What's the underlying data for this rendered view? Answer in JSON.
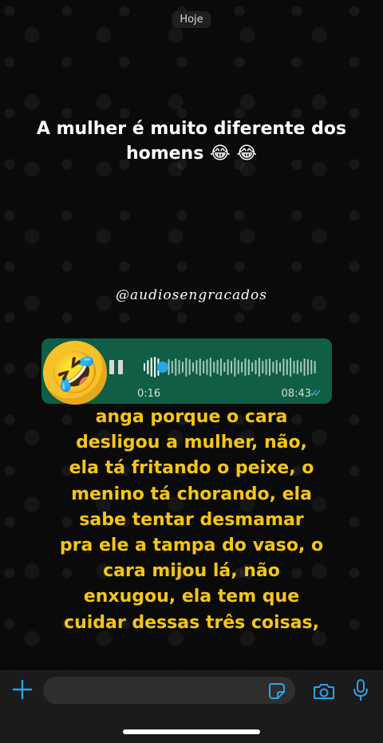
{
  "chat": {
    "date_chip": "Hoje",
    "overlay_title": "A mulher é muito diferente dos homens 😂 😂",
    "watermark": "@audiosengracados",
    "voice_message": {
      "avatar_emoji": "🤣",
      "duration": "0:16",
      "time": "08:43",
      "status": "read",
      "progress": 0.1
    },
    "caption": "anga porque o cara\ndesligou a mulher, não,\nela tá fritando o peixe, o\nmenino tá chorando, ela\nsabe tentar desmamar\npra ele a tampa do vaso, o\ncara mijou lá, não\nenxugou, ela tem que\ncuidar dessas três coisas,"
  },
  "composer": {
    "plus_icon": "plus-icon",
    "input_value": "",
    "sticker_icon": "sticker-icon",
    "camera_icon": "camera-icon",
    "mic_icon": "microphone-icon"
  },
  "colors": {
    "bubble": "#0f5e45",
    "accent": "#2aa3e8",
    "caption": "#f5c518",
    "read_ticks": "#53bdeb"
  }
}
